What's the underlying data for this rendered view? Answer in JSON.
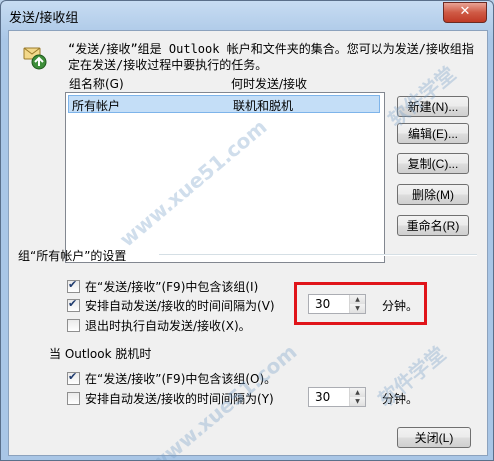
{
  "window": {
    "title": "发送/接收组",
    "close_glyph": "✕"
  },
  "description": "“发送/接收”组是 Outlook 帐户和文件夹的集合。您可以为发送/接收组指定在发送/接收过程中要执行的任务。",
  "list": {
    "col_name": "组名称(G)",
    "col_when": "何时发送/接收",
    "rows": [
      {
        "name": "所有帐户",
        "when": "联机和脱机"
      }
    ]
  },
  "buttons": {
    "new": "新建(N)...",
    "edit": "编辑(E)...",
    "copy": "复制(C)...",
    "delete": "删除(M)",
    "rename": "重命名(R)",
    "close": "关闭(L)"
  },
  "online_section": {
    "heading": "组“所有帐户”的设置",
    "include_label": "在“发送/接收”(F9)中包含该组(I)",
    "include_checked": true,
    "auto_label": "安排自动发送/接收的时间间隔为(V)",
    "auto_checked": true,
    "auto_value": "30",
    "unit": "分钟。",
    "exit_label": "退出时执行自动发送/接收(X)。",
    "exit_checked": false
  },
  "offline_section": {
    "heading": "当 Outlook 脱机时",
    "include_label": "在“发送/接收”(F9)中包含该组(O)。",
    "include_checked": true,
    "auto_label": "安排自动发送/接收的时间间隔为(Y)",
    "auto_checked": false,
    "auto_value": "30",
    "unit": "分钟。"
  },
  "watermark": {
    "text1": "软件学堂",
    "text2": "www.xue51.com"
  },
  "colors": {
    "highlight": "#e0141a",
    "selection": "#c4def7",
    "dialog_bg": "#f0f0f0"
  }
}
